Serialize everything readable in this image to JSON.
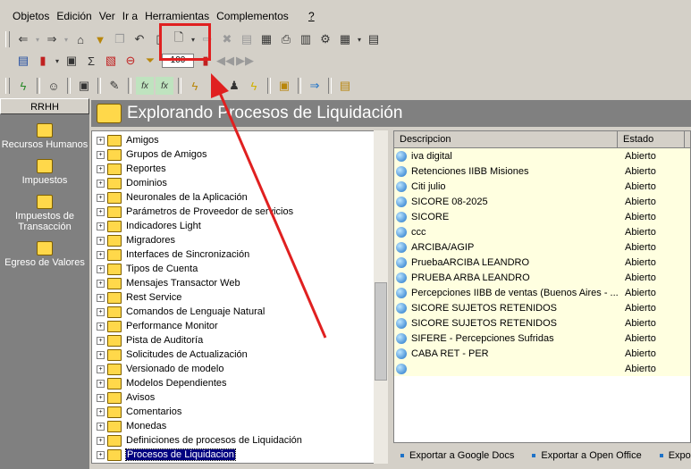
{
  "menu": [
    "Objetos",
    "Edición",
    "Ver",
    "Ir a",
    "Herramientas",
    "Complementos"
  ],
  "menu_help": "?",
  "toolbar": {
    "zoom_value": "100"
  },
  "left_panel": {
    "header": "RRHH",
    "items": [
      "Recursos Humanos",
      "Impuestos",
      "Impuestos de Transacción",
      "Egreso de Valores"
    ]
  },
  "header_title": "Explorando Procesos de Liquidación",
  "tree_items": [
    "Amigos",
    "Grupos de Amigos",
    "Reportes",
    "Dominios",
    "Neuronales de la Aplicación",
    "Parámetros de Proveedor de servicios",
    "Indicadores Light",
    "Migradores",
    "Interfaces de Sincronización",
    "Tipos de Cuenta",
    "Mensajes Transactor Web",
    "Rest Service",
    "Comandos de Lenguaje Natural",
    "Performance Monitor",
    "Pista de Auditoría",
    "Solicitudes de Actualización",
    "Versionado de modelo",
    "Modelos Dependientes",
    "Avisos",
    "Comentarios",
    "Monedas",
    "Definiciones de procesos de Liquidación",
    "Procesos de Liquidacion"
  ],
  "tree_selected": "Procesos de Liquidacion",
  "list": {
    "columns": [
      "Descripcion",
      "Estado"
    ],
    "rows": [
      {
        "desc": "iva digital",
        "estado": "Abierto"
      },
      {
        "desc": "Retenciones IIBB Misiones",
        "estado": "Abierto"
      },
      {
        "desc": "Citi julio",
        "estado": "Abierto"
      },
      {
        "desc": "SICORE 08-2025",
        "estado": "Abierto"
      },
      {
        "desc": "SICORE",
        "estado": "Abierto"
      },
      {
        "desc": "ccc",
        "estado": "Abierto"
      },
      {
        "desc": "ARCIBA/AGIP",
        "estado": "Abierto"
      },
      {
        "desc": "PruebaARCIBA LEANDRO",
        "estado": "Abierto"
      },
      {
        "desc": "PRUEBA ARBA LEANDRO",
        "estado": "Abierto"
      },
      {
        "desc": "Percepciones IIBB de ventas (Buenos Aires - ...",
        "estado": "Abierto"
      },
      {
        "desc": "SICORE SUJETOS RETENIDOS",
        "estado": "Abierto"
      },
      {
        "desc": "SICORE SUJETOS RETENIDOS",
        "estado": "Abierto"
      },
      {
        "desc": "SIFERE - Percepciones Sufridas",
        "estado": "Abierto"
      },
      {
        "desc": "CABA RET - PER",
        "estado": "Abierto"
      },
      {
        "desc": "",
        "estado": "Abierto"
      }
    ]
  },
  "bottom_links": [
    "Exportar a Google Docs",
    "Exportar a Open Office",
    "Export"
  ],
  "colors": {
    "annotation": "#e02020",
    "selection": "#000080",
    "list_row_bg": "#ffffe0"
  }
}
